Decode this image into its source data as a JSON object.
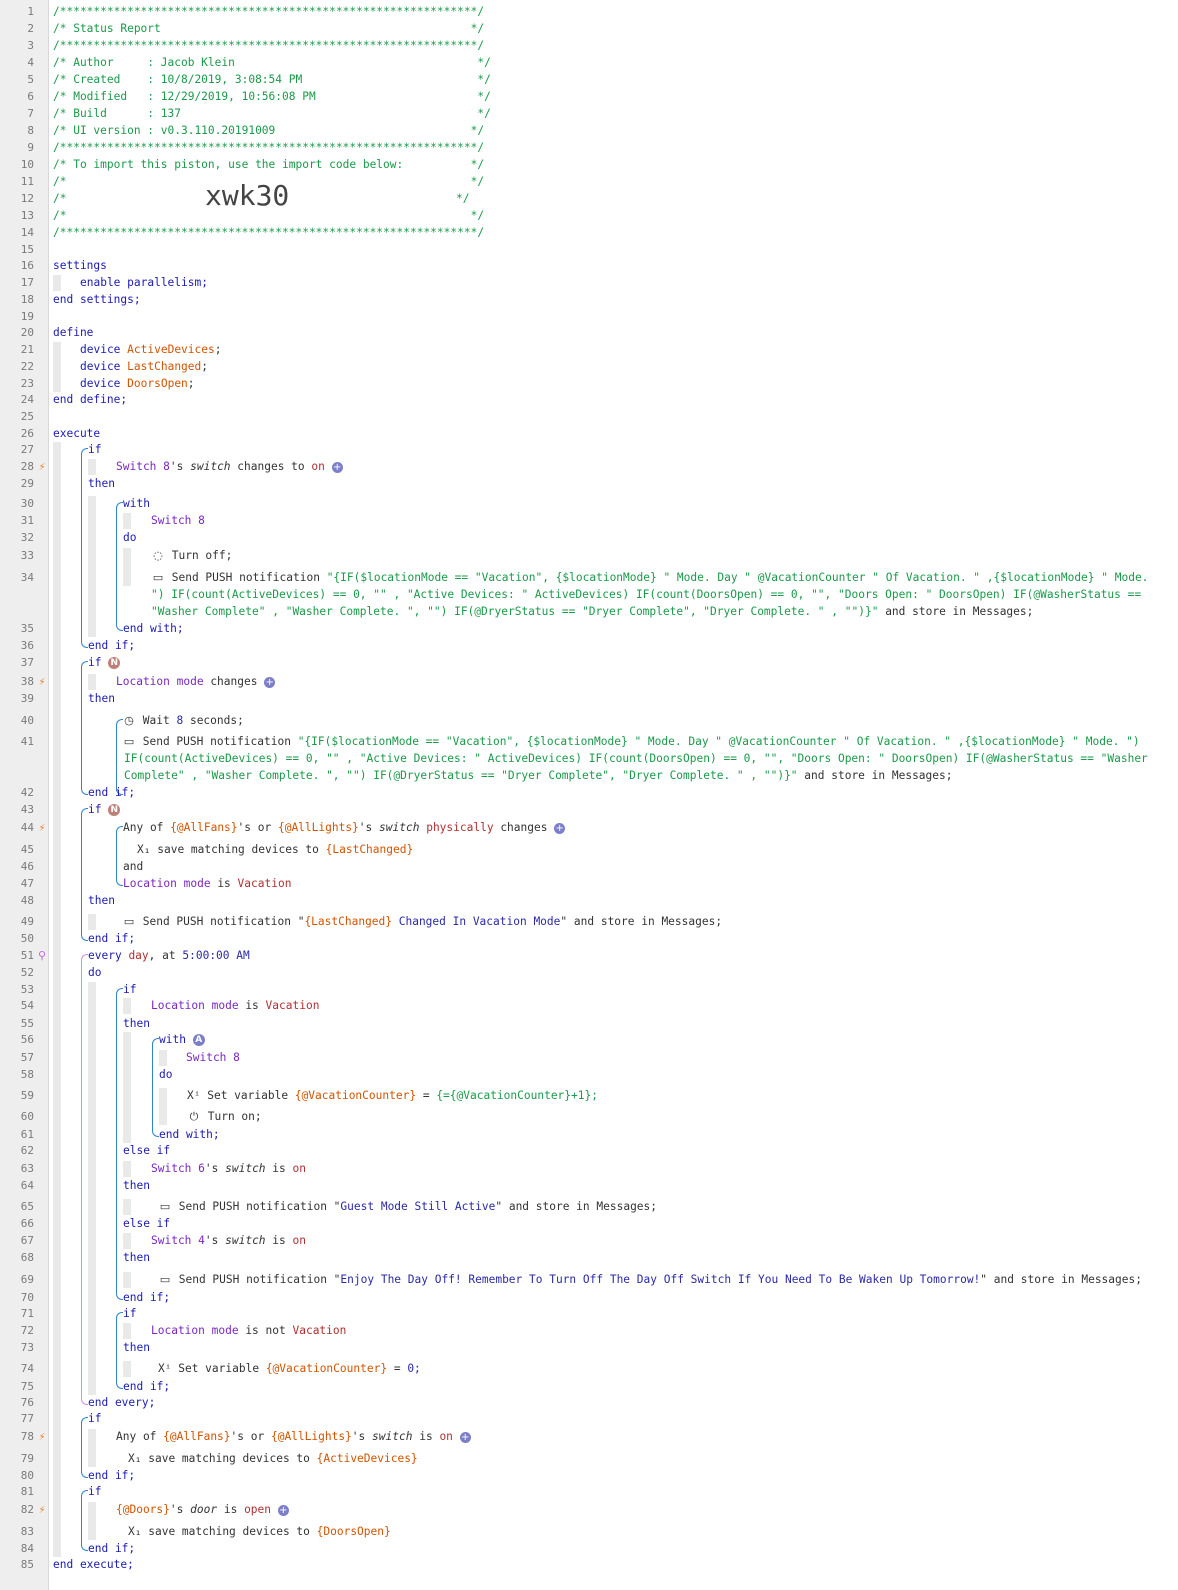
{
  "line_numbers": [
    "1",
    "2",
    "3",
    "4",
    "5",
    "6",
    "7",
    "8",
    "9",
    "10",
    "11",
    "12",
    "13",
    "14",
    "15",
    "16",
    "17",
    "18",
    "19",
    "20",
    "21",
    "22",
    "23",
    "24",
    "25",
    "26",
    "27",
    "28",
    "29",
    "30",
    "31",
    "32",
    "33",
    "34",
    "35",
    "36",
    "37",
    "38",
    "39",
    "40",
    "41",
    "42",
    "43",
    "44",
    "45",
    "46",
    "47",
    "48",
    "49",
    "50",
    "51",
    "52",
    "53",
    "54",
    "55",
    "56",
    "57",
    "58",
    "59",
    "60",
    "61",
    "62",
    "63",
    "64",
    "65",
    "66",
    "67",
    "68",
    "69",
    "70",
    "71",
    "72",
    "73",
    "74",
    "75",
    "76",
    "77",
    "78",
    "79",
    "80",
    "81",
    "82",
    "83",
    "84",
    "85"
  ],
  "header": {
    "stars": "/**************************************************************/",
    "title": "/* Status Report                                              */",
    "author": "/* Author     : Jacob Klein                                    */",
    "created": "/* Created    : 10/8/2019, 3:08:54 PM                          */",
    "modified": "/* Modified   : 12/29/2019, 10:56:08 PM                        */",
    "build": "/* Build      : 137                                            */",
    "ui_version": "/* UI version : v0.3.110.20191009                             */",
    "import_note": "/* To import this piston, use the import code below:          */",
    "blank": "/*                                                            */",
    "blank_pre": "/*",
    "blank_post": "*/",
    "import_code": "xwk30"
  },
  "settings": {
    "open": "settings",
    "body": "enable parallelism;",
    "close": "end settings;"
  },
  "define": {
    "open": "define",
    "devices": [
      {
        "kw": "device",
        "name": "ActiveDevices"
      },
      {
        "kw": "device",
        "name": "LastChanged"
      },
      {
        "kw": "device",
        "name": "DoorsOpen"
      }
    ],
    "close": "end define;"
  },
  "execute": {
    "open": "execute",
    "close": "end execute;",
    "if": "if",
    "then": "then",
    "end_if": "end if;",
    "with": "with",
    "do": "do",
    "end_with": "end with;",
    "and": "and",
    "else_if": "else if",
    "every": "every",
    "day": "day",
    "at": "at",
    "end_every": "end every;",
    "switch8": "Switch 8",
    "switch6": "Switch 6",
    "switch4": "Switch 4",
    "switch_attr": "switch",
    "door_attr": "door",
    "changes_to": "changes to",
    "changes": "changes",
    "is": "is",
    "is_not": "is not",
    "on": "on",
    "open_val": "open",
    "location_mode": "Location mode",
    "turn_off": "Turn off;",
    "turn_on": "Turn on;",
    "send_push": "Send PUSH notification",
    "store_in": "and store in Messages;",
    "wait": "Wait",
    "wait_secs": "8",
    "seconds": "seconds;",
    "push_long_1a": "\"{IF($locationMode == \"Vacation\", {$locationMode} \" Mode. Day \" @VacationCounter \" Of Vacation. \" ,{$locationMode} \" Mode.",
    "push_long_1b": "\") IF(count(ActiveDevices) == 0, \"\" , \"Active Devices: \" ActiveDevices) IF(count(DoorsOpen) == 0, \"\", \"Doors Open: \" DoorsOpen) IF(@WasherStatus ==",
    "push_long_1c": "\"Washer Complete\" , \"Washer Complete. \", \"\") IF(@DryerStatus == \"Dryer Complete\", \"Dryer Complete. \" , \"\")}\"",
    "push_long_2a": "\"{IF($locationMode == \"Vacation\", {$locationMode} \" Mode. Day \" @VacationCounter \" Of Vacation. \" ,{$locationMode} \" Mode. \")",
    "push_long_2b": "IF(count(ActiveDevices) == 0, \"\" , \"Active Devices: \" ActiveDevices) IF(count(DoorsOpen) == 0, \"\", \"Doors Open: \" DoorsOpen) IF(@WasherStatus == \"Washer",
    "push_long_2c": "Complete\" , \"Washer Complete. \", \"\") IF(@DryerStatus == \"Dryer Complete\", \"Dryer Complete. \" , \"\")}\"",
    "any_of": "Any of",
    "all_fans": "{@AllFans}",
    "all_lights": "{@AllLights}",
    "s_or": "'s or",
    "s": "'s",
    "physically": "physically",
    "save_matching": "save matching devices to",
    "var_last_changed": "{LastChanged}",
    "var_active_devices": "{ActiveDevices}",
    "var_doors_open": "{DoorsOpen}",
    "vacation": "Vacation",
    "push_vacation_open": "\"",
    "push_vacation_var": "{LastChanged}",
    "push_vacation_text": " Changed In Vacation Mode",
    "push_vacation_close": "\"",
    "time": "5:00:00 AM",
    "set_variable": "Set variable",
    "vacation_counter": "{@VacationCounter}",
    "eq": "=",
    "counter_expr": "{={@VacationCounter}+1};",
    "zero": "0;",
    "guest_msg": "Guest Mode Still Active",
    "dayoff_msg": "Enjoy The Day Off! Remember To Turn Off The Day Off Switch If You Need To Be Waken Up Tomorrow!",
    "doors": "{@Doors}",
    "badge_n": "N",
    "badge_a": "A",
    "plus": "+",
    "x_icon": "X₁",
    "xi_icon": "Xⁱ"
  },
  "colors": {
    "keyword": "#1b1bb3",
    "variable": "#d35400",
    "device": "#7a28c0",
    "string": "#1a9a4a",
    "enum_value": "#b03030",
    "trigger": "#e67e22"
  }
}
